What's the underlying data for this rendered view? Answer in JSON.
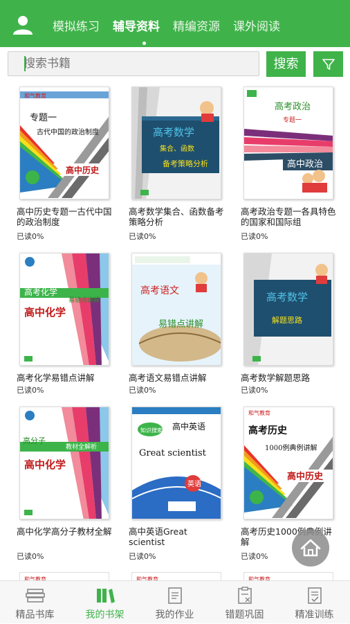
{
  "header": {
    "tabs": [
      {
        "label": "模拟练习",
        "active": false
      },
      {
        "label": "辅导资料",
        "active": true
      },
      {
        "label": "精编资源",
        "active": false
      },
      {
        "label": "课外阅读",
        "active": false
      }
    ]
  },
  "search": {
    "placeholder": "搜索书籍",
    "button_label": "搜索"
  },
  "books": [
    {
      "title": "高中历史专题一古代中国的政治制度",
      "progress": "已读0%",
      "cover": {
        "top_text": "专题一",
        "sub_text": "古代中国的政治制度",
        "label": "高中历史",
        "publisher": "和气教育"
      }
    },
    {
      "title": "高考数学集合、函数备考策略分析",
      "progress": "已读0%",
      "cover": {
        "title": "高考数学",
        "sub_text": "集合、函数",
        "label": "备考策略分析"
      }
    },
    {
      "title": "高考政治专题一各具特色的国家和国际组",
      "progress": "已读0%",
      "cover": {
        "title": "高考政治",
        "sub_text": "专题一",
        "label": "高中政治"
      }
    },
    {
      "title": "高考化学易错点讲解",
      "progress": "已读0%",
      "cover": {
        "title": "高考化学",
        "sub_text": "易错点讲解",
        "label": "高中化学"
      }
    },
    {
      "title": "高考语文易错点讲解",
      "progress": "已读0%",
      "cover": {
        "title": "高考语文",
        "label": "易错点讲解"
      }
    },
    {
      "title": "高考数学解题思路",
      "progress": "已读0%",
      "cover": {
        "title": "高考数学",
        "label": "解题思路"
      }
    },
    {
      "title": "高中化学高分子教材全解",
      "progress": "已读0%",
      "cover": {
        "title": "高分子",
        "sub_text": "教材全解析",
        "label": "高中化学"
      }
    },
    {
      "title": "高中英语Great scientist",
      "progress": "已读0%",
      "cover": {
        "title": "高中英语",
        "sub_text": "Great scientist",
        "badge": "英语"
      }
    },
    {
      "title": "高考历史1000例典例讲解",
      "progress": "已读0%",
      "cover": {
        "title": "高考历史",
        "sub_text": "1000例典例讲解",
        "label": "高中历史",
        "publisher": "和气教育"
      }
    }
  ],
  "bottom_nav": [
    {
      "label": "精品书库",
      "icon": "books-stack-icon",
      "active": false
    },
    {
      "label": "我的书架",
      "icon": "bookshelf-icon",
      "active": true
    },
    {
      "label": "我的作业",
      "icon": "homework-icon",
      "active": false
    },
    {
      "label": "错题巩固",
      "icon": "wrong-questions-icon",
      "active": false
    },
    {
      "label": "精准训练",
      "icon": "training-icon",
      "active": false
    }
  ],
  "colors": {
    "accent": "#3fb34a",
    "inactive": "#666666"
  }
}
